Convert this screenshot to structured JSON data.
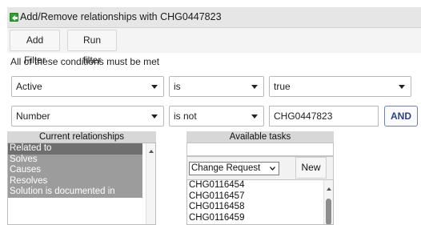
{
  "header": {
    "title": "Add/Remove relationships with CHG0447823",
    "back_icon": "back-arrow-icon"
  },
  "toolbar": {
    "add_filter": "Add Filter",
    "run_filter": "Run filter"
  },
  "hint": "All of these conditions must be met",
  "conditions": [
    {
      "field": "Active",
      "operator": "is",
      "value": "true"
    },
    {
      "field": "Number",
      "operator": "is not",
      "value": "CHG0447823",
      "action": "AND"
    }
  ],
  "current_relationships": {
    "header": "Current relationships",
    "items": [
      "Related to",
      "Solves",
      "Causes",
      "Resolves",
      "Solution is documented in"
    ]
  },
  "available_tasks": {
    "header": "Available tasks",
    "type_select": "Change Request",
    "new_label": "New",
    "items": [
      "CHG0116454",
      "CHG0116457",
      "CHG0116458",
      "CHG0116459"
    ]
  },
  "colors": {
    "accent": "#2a3f8f",
    "selected_row": "#6f6f6f",
    "list_row": "#9c9c9c",
    "back_icon": "#2fa32f"
  }
}
